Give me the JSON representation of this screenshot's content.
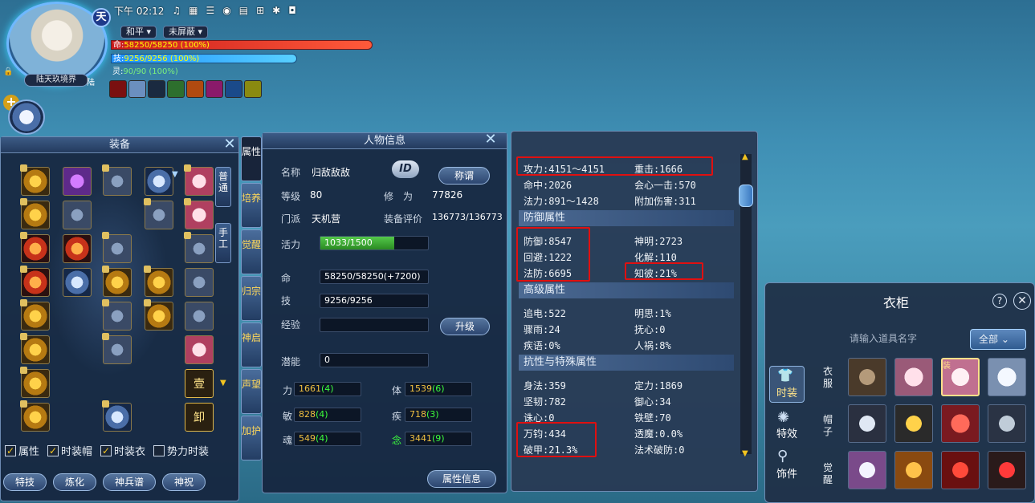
{
  "hud": {
    "time": "下午 02:12",
    "badge": "天",
    "player_name": "陆天玖境界",
    "badge_corner": "陆",
    "mode_peace": "和平",
    "mode_shield": "未屏蔽",
    "hp": {
      "label": "命:",
      "value": "58250/58250",
      "pct": "(100%)",
      "fraction": 1.0
    },
    "mp": {
      "label": "技:",
      "value": "9256/9256",
      "pct": "(100%)",
      "fraction": 1.0
    },
    "sp": {
      "label": "灵:",
      "value": "90/90",
      "pct": "(100%)",
      "fraction": 1.0
    }
  },
  "equip": {
    "title": "装备",
    "tabs": [
      "普通",
      "手工"
    ],
    "slot_text_1": "壹",
    "slot_text_2": "卸",
    "checks": [
      {
        "label": "属性",
        "checked": true
      },
      {
        "label": "时装帽",
        "checked": true
      },
      {
        "label": "时装衣",
        "checked": true
      },
      {
        "label": "势力时装",
        "checked": false
      }
    ],
    "buttons": [
      "特技",
      "炼化",
      "神兵谱",
      "神祝"
    ]
  },
  "sidetabs": [
    "属性",
    "培养",
    "觉醒",
    "归宗",
    "神启",
    "声望",
    "加护"
  ],
  "info": {
    "title": "人物信息",
    "name_label": "名称",
    "name_value": "归敌敌敌",
    "id_button": "ID",
    "title_button": "称谓",
    "level_label": "等级",
    "level_value": "80",
    "cultivation_label": "修　为",
    "cultivation_value": "77826",
    "sect_label": "门派",
    "sect_value": "天机营",
    "rating_label": "装备评价",
    "rating_value": "136773/136773",
    "vitality_label": "活力",
    "vitality_value": "1033/1500",
    "vitality_fraction": 0.69,
    "hp_label": "命",
    "hp_value": "58250/58250(+7200)",
    "mp_label": "技",
    "mp_value": "9256/9256",
    "exp_label": "经验",
    "exp_value": "",
    "upgrade_button": "升级",
    "potential_label": "潜能",
    "potential_value": "0",
    "attrs": [
      {
        "label": "力",
        "value": "1661",
        "bonus": "(4)"
      },
      {
        "label": "体",
        "value": "1539",
        "bonus": "(6)"
      },
      {
        "label": "敏",
        "value": "828",
        "bonus": "(4)"
      },
      {
        "label": "疾",
        "value": "718",
        "bonus": "(3)"
      },
      {
        "label": "魂",
        "value": "549",
        "bonus": "(4)"
      },
      {
        "label": "念",
        "value": "3441",
        "bonus": "(9)"
      }
    ],
    "attr_info_button": "属性信息"
  },
  "stats": {
    "rows_top": [
      [
        "攻力:4151～4151",
        "重击:1666"
      ],
      [
        "命中:2026",
        "会心一击:570"
      ],
      [
        "法力:891～1428",
        "附加伤害:311"
      ]
    ],
    "section_defense": "防御属性",
    "rows_def": [
      [
        "防御:8547",
        "神明:2723"
      ],
      [
        "回避:1222",
        "化解:110"
      ],
      [
        "法防:6695",
        "知彼:21%"
      ]
    ],
    "section_advanced": "高级属性",
    "rows_adv": [
      [
        "追电:522",
        "明思:1%"
      ],
      [
        "骤雨:24",
        "抚心:0"
      ],
      [
        "疾语:0%",
        "人祸:8%"
      ]
    ],
    "section_resist": "抗性与特殊属性",
    "rows_res": [
      [
        "身法:359",
        "定力:1869"
      ],
      [
        "坚韧:782",
        "御心:34"
      ],
      [
        "诛心:0",
        "铁壁:70"
      ],
      [
        "万钧:434",
        "透魔:0.0%"
      ],
      [
        "破甲:21.3%",
        "法术破防:0"
      ]
    ]
  },
  "wardrobe": {
    "title": "衣柜",
    "search_placeholder": "请输入道具名字",
    "filter": "全部",
    "categories": [
      "时装",
      "特效",
      "饰件"
    ],
    "vtabs": [
      "衣服",
      "帽子",
      "觉醒"
    ],
    "equipped_tag": "装"
  },
  "colors": {
    "hp": "#d42020",
    "mp": "#2aa8ff",
    "highlight": "#e01010",
    "gold": "#f0c040"
  }
}
